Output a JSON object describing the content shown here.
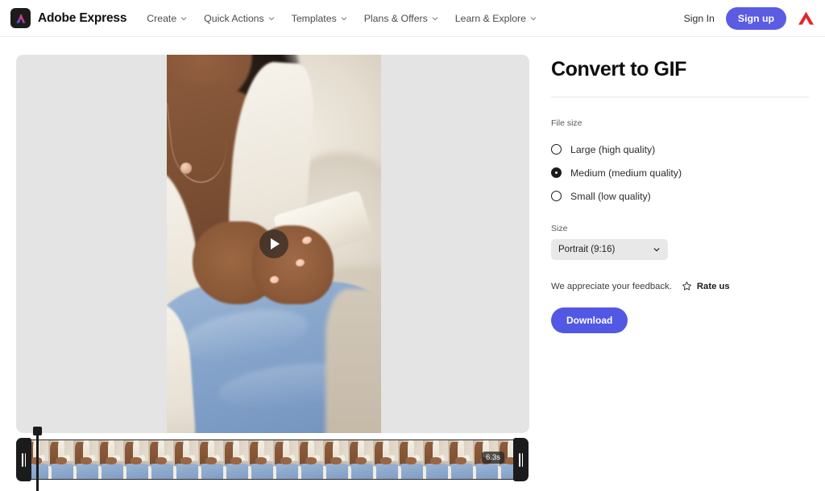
{
  "header": {
    "brand": "Adobe Express",
    "logo_icon": "adobe-express-logo-icon",
    "nav": [
      {
        "label": "Create",
        "icon": "chevron-down-icon"
      },
      {
        "label": "Quick Actions",
        "icon": "chevron-down-icon"
      },
      {
        "label": "Templates",
        "icon": "chevron-down-icon"
      },
      {
        "label": "Plans & Offers",
        "icon": "chevron-down-icon"
      },
      {
        "label": "Learn & Explore",
        "icon": "chevron-down-icon"
      }
    ],
    "sign_in": "Sign In",
    "sign_up": "Sign up",
    "adobe_mark_icon": "adobe-a-logo-icon",
    "signup_color": "#5b5ce2"
  },
  "stage": {
    "play_icon": "play-icon",
    "canvas_color": "#e4e4e4"
  },
  "timeline": {
    "duration": "6.3s",
    "frame_count": 20,
    "left_handle_icon": "trim-handle-left-icon",
    "right_handle_icon": "trim-handle-right-icon",
    "playhead_icon": "playhead-icon"
  },
  "panel": {
    "title": "Convert to GIF",
    "file_size_label": "File size",
    "file_size_options": [
      {
        "label": "Large (high quality)",
        "selected": false
      },
      {
        "label": "Medium (medium quality)",
        "selected": true
      },
      {
        "label": "Small (low quality)",
        "selected": false
      }
    ],
    "size_label": "Size",
    "size_value": "Portrait (9:16)",
    "size_chevron_icon": "chevron-down-icon",
    "feedback_text": "We appreciate your feedback.",
    "star_icon": "star-outline-icon",
    "rate_us": "Rate us",
    "download_label": "Download",
    "download_color": "#5258e4"
  }
}
